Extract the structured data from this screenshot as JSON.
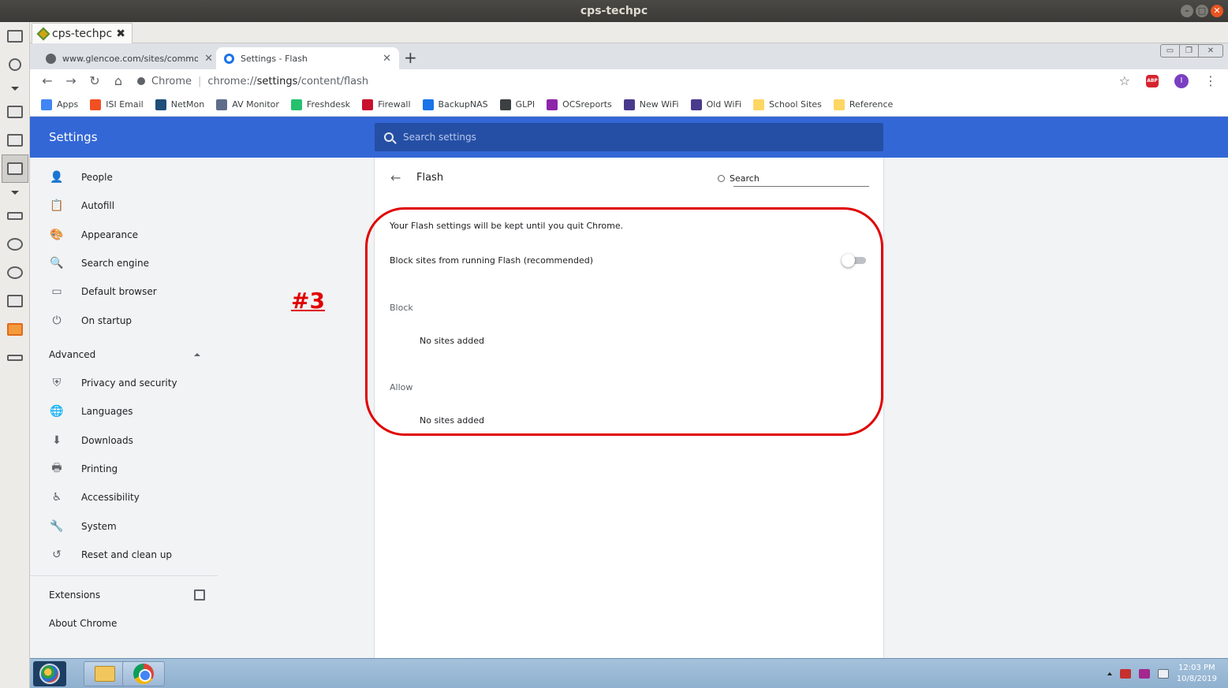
{
  "os": {
    "window_title": "cps-techpc"
  },
  "remote_tab": {
    "label": "cps-techpc",
    "close": "✖"
  },
  "chrome": {
    "tabs": [
      {
        "title": "www.glencoe.com/sites/common",
        "close": "✕"
      },
      {
        "title": "Settings - Flash",
        "close": "✕"
      }
    ],
    "new_tab": "+",
    "url": {
      "site_label": "Chrome",
      "scheme": "chrome://",
      "host": "settings",
      "path": "/content/flash"
    },
    "profile_initial": "I",
    "abp_label": "ABP"
  },
  "bookmarks": [
    {
      "label": "Apps",
      "color": "#4285f4"
    },
    {
      "label": "ISI Email",
      "color": "#f25022"
    },
    {
      "label": "NetMon",
      "color": "#1f4e79"
    },
    {
      "label": "AV Monitor",
      "color": "#5f6d8a"
    },
    {
      "label": "Freshdesk",
      "color": "#25c16f"
    },
    {
      "label": "Firewall",
      "color": "#c8102e"
    },
    {
      "label": "BackupNAS",
      "color": "#1a73e8"
    },
    {
      "label": "GLPI",
      "color": "#3c4043"
    },
    {
      "label": "OCSreports",
      "color": "#8e24aa"
    },
    {
      "label": "New WiFi",
      "color": "#4a3a8c"
    },
    {
      "label": "Old WiFi",
      "color": "#4a3a8c"
    },
    {
      "label": "School Sites",
      "color": "#fdd663"
    },
    {
      "label": "Reference",
      "color": "#fdd663"
    }
  ],
  "settings": {
    "title": "Settings",
    "search_placeholder": "Search settings",
    "nav": [
      {
        "label": "People",
        "icon": "person-icon",
        "glyph": "👤"
      },
      {
        "label": "Autofill",
        "icon": "clipboard-icon",
        "glyph": "📋"
      },
      {
        "label": "Appearance",
        "icon": "palette-icon",
        "glyph": "🎨"
      },
      {
        "label": "Search engine",
        "icon": "search-icon",
        "glyph": "🔍"
      },
      {
        "label": "Default browser",
        "icon": "browser-icon",
        "glyph": "▭"
      },
      {
        "label": "On startup",
        "icon": "power-icon",
        "glyph": "⏻"
      }
    ],
    "advanced_label": "Advanced",
    "advanced_nav": [
      {
        "label": "Privacy and security",
        "icon": "shield-icon",
        "glyph": "⛨"
      },
      {
        "label": "Languages",
        "icon": "globe-icon",
        "glyph": "🌐"
      },
      {
        "label": "Downloads",
        "icon": "download-icon",
        "glyph": "⬇"
      },
      {
        "label": "Printing",
        "icon": "printer-icon",
        "glyph": "🖶"
      },
      {
        "label": "Accessibility",
        "icon": "accessibility-icon",
        "glyph": "♿"
      },
      {
        "label": "System",
        "icon": "wrench-icon",
        "glyph": "🔧"
      },
      {
        "label": "Reset and clean up",
        "icon": "history-icon",
        "glyph": "↺"
      }
    ],
    "extensions_label": "Extensions",
    "about_label": "About Chrome"
  },
  "flash": {
    "page_title": "Flash",
    "search_label": "Search",
    "note": "Your Flash settings will be kept until you quit Chrome.",
    "block_toggle_label": "Block sites from running Flash (recommended)",
    "block_toggle_on": false,
    "block_heading": "Block",
    "block_empty": "No sites added",
    "allow_heading": "Allow",
    "allow_empty": "No sites added"
  },
  "annotation": {
    "text": "#3",
    "color": "#e00000"
  },
  "taskbar": {
    "time": "12:03 PM",
    "date": "10/8/2019"
  }
}
